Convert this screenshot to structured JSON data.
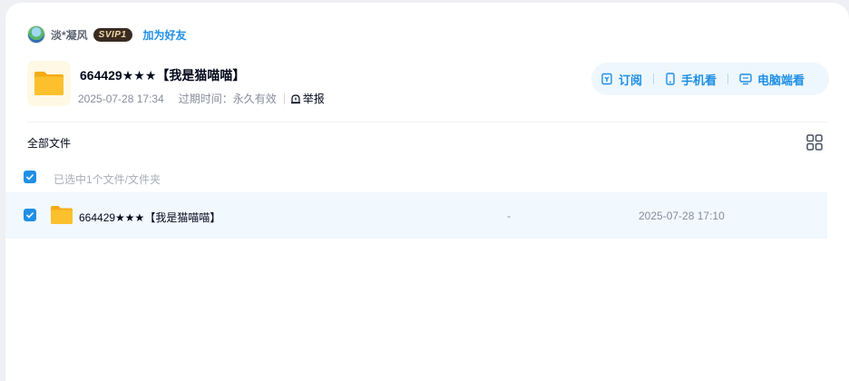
{
  "user": {
    "avatar_icon": "avatar-icon",
    "name": "淡*凝风",
    "badge": "SVIP1",
    "add_friend_label": "加为好友"
  },
  "share": {
    "title": "664429★★★【我是猫喵喵】",
    "created": "2025-07-28 17:34",
    "expire_label": "过期时间：",
    "expire_value": "永久有效",
    "report_label": "举报"
  },
  "actions": [
    {
      "label": "订阅",
      "icon": "subscribe-icon"
    },
    {
      "label": "手机看",
      "icon": "phone-icon"
    },
    {
      "label": "电脑端看",
      "icon": "desktop-icon"
    }
  ],
  "list": {
    "breadcrumb": "全部文件",
    "selected_info": "已选中1个文件/文件夹",
    "view_toggle_icon": "grid-view-icon",
    "files": [
      {
        "name": "664429★★★【我是猫喵喵】",
        "size": "-",
        "date": "2025-07-28 17:10",
        "selected": true
      }
    ]
  },
  "colors": {
    "accent": "#1e8fe6",
    "row_selected_bg": "#f1f8fe",
    "action_bar_bg": "#eef7fd",
    "folder": "#fcc02d"
  }
}
